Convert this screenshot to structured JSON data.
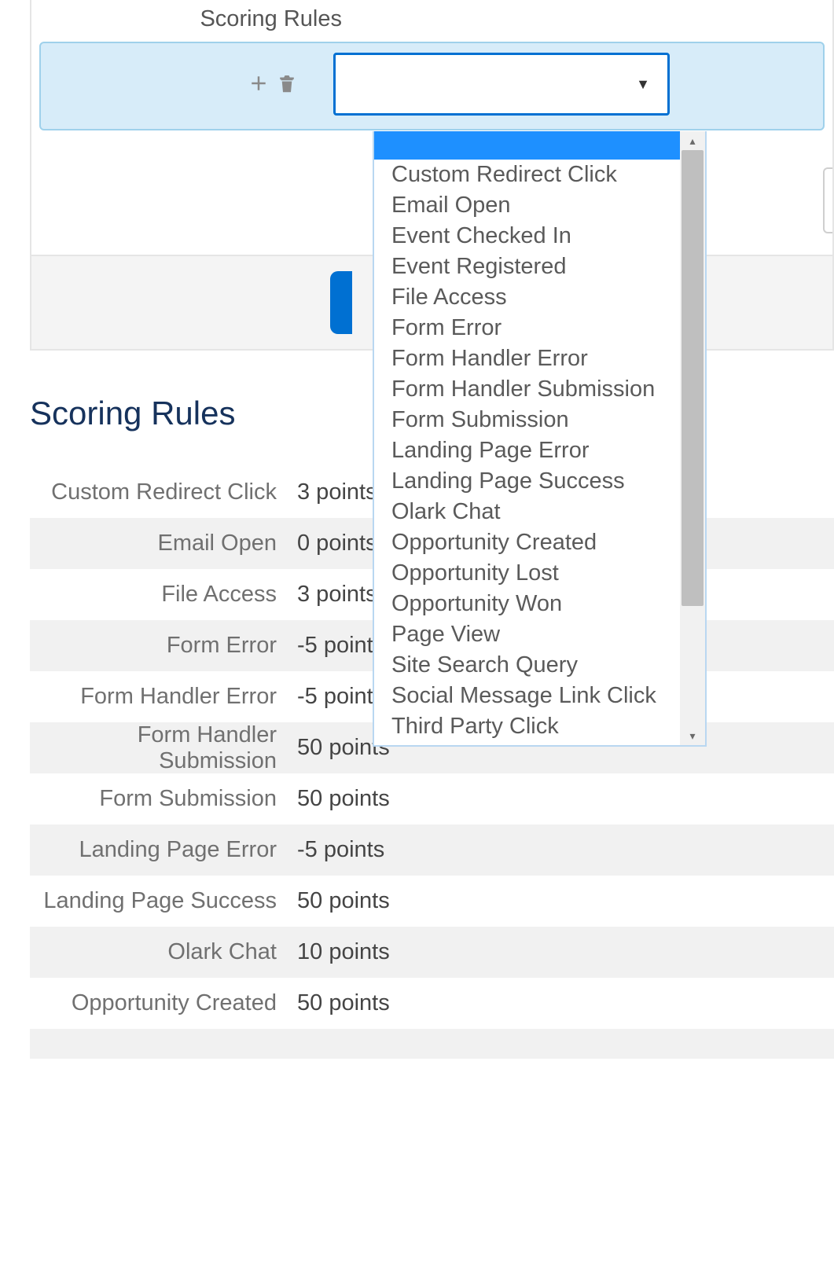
{
  "panel": {
    "label": "Scoring Rules",
    "select_value": "",
    "caret": "▼"
  },
  "dropdown": {
    "options": [
      "Custom Redirect Click",
      "Email Open",
      "Event Checked In",
      "Event Registered",
      "File Access",
      "Form Error",
      "Form Handler Error",
      "Form Handler Submission",
      "Form Submission",
      "Landing Page Error",
      "Landing Page Success",
      "Olark Chat",
      "Opportunity Created",
      "Opportunity Lost",
      "Opportunity Won",
      "Page View",
      "Site Search Query",
      "Social Message Link Click",
      "Third Party Click"
    ],
    "scroll_up": "▴",
    "scroll_down": "▾"
  },
  "section": {
    "title": "Scoring Rules"
  },
  "rules": [
    {
      "label": "Custom Redirect Click",
      "value": "3 points"
    },
    {
      "label": "Email Open",
      "value": "0 points"
    },
    {
      "label": "File Access",
      "value": "3 points"
    },
    {
      "label": "Form Error",
      "value": "-5 points"
    },
    {
      "label": "Form Handler Error",
      "value": "-5 points"
    },
    {
      "label": "Form Handler Submission",
      "value": "50 points"
    },
    {
      "label": "Form Submission",
      "value": "50 points"
    },
    {
      "label": "Landing Page Error",
      "value": "-5 points"
    },
    {
      "label": "Landing Page Success",
      "value": "50 points"
    },
    {
      "label": "Olark Chat",
      "value": "10 points"
    },
    {
      "label": "Opportunity Created",
      "value": "50 points"
    }
  ]
}
